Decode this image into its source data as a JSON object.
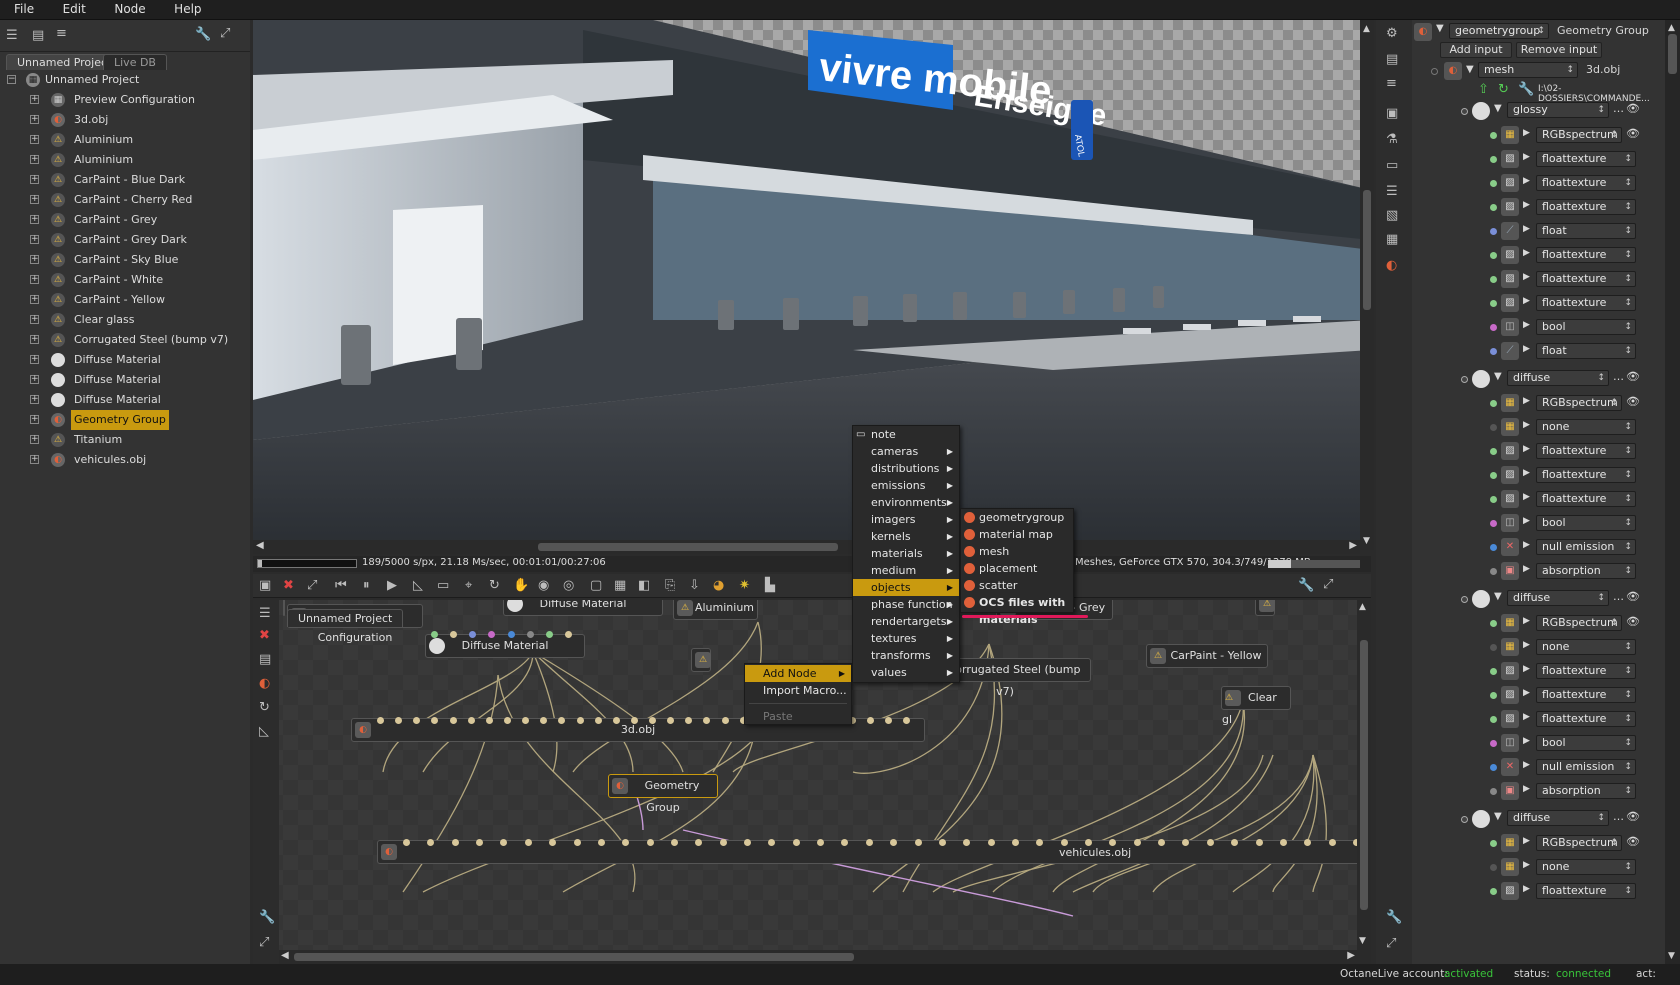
{
  "menubar": {
    "file": "File",
    "edit": "Edit",
    "node": "Node",
    "help": "Help"
  },
  "outliner": {
    "tabs": [
      "Unnamed Project",
      "Live DB"
    ],
    "root": "Unnamed Project",
    "items": [
      "Preview Configuration",
      "3d.obj",
      "Aluminium",
      "Aluminium",
      "CarPaint - Blue Dark",
      "CarPaint - Cherry Red",
      "CarPaint - Grey",
      "CarPaint - Grey Dark",
      "CarPaint - Sky Blue",
      "CarPaint - White",
      "CarPaint - Yellow",
      "Clear glass",
      "Corrugated Steel (bump v7)",
      "Diffuse Material",
      "Diffuse Material",
      "Diffuse Material",
      "Geometry Group",
      "Titanium",
      "vehicules.obj"
    ],
    "selected_index": 16
  },
  "viewport": {
    "signs": [
      "vivre mobile",
      "Enseigne",
      "ATOL"
    ],
    "status_left": "189/5000 s/px, 21.18 Ms/sec, 00:01:01/00:27:06",
    "status_right": "Meshes, GeForce GTX 570, 304.3/749/1279 MB",
    "render_progress": 0.038
  },
  "nodegraph": {
    "tab": "Unnamed Project",
    "nodes": {
      "preview": "Preview Configuration",
      "diffuse1": "Diffuse Material",
      "diffuse2": "Diffuse Material",
      "aluminium": "Aluminium",
      "carpaint_grey": "CarPaint - Grey",
      "carpaint_yellow": "CarPaint - Yellow",
      "corrugated": "Corrugated Steel (bump v7)",
      "clear": "Clear gl",
      "obj3d": "3d.obj",
      "geogroup": "Geometry Group",
      "vehicules": "vehicules.obj"
    }
  },
  "context_menu": {
    "add_node": "Add Node",
    "import_macro": "Import Macro...",
    "paste": "Paste"
  },
  "addnode_menu": [
    "note",
    "cameras",
    "distributions",
    "emissions",
    "environments",
    "imagers",
    "kernels",
    "materials",
    "medium",
    "objects",
    "phase function",
    "rendertargets",
    "textures",
    "transforms",
    "values"
  ],
  "objects_menu": [
    "geometrygroup",
    "material map",
    "mesh",
    "placement",
    "scatter",
    "OCS files with materials"
  ],
  "inspector": {
    "node_type": "geometrygroup",
    "node_name": "Geometry Group",
    "add_input": "Add input",
    "remove_input": "Remove input",
    "mesh_type": "mesh",
    "mesh_name": "3d.obj",
    "mesh_path": "I:\\02-DOSSIERS\\COMMANDE...",
    "groups": [
      {
        "type": "glossy",
        "items": [
          "RGBspectrum",
          "floattexture",
          "floattexture",
          "floattexture",
          "float",
          "floattexture",
          "floattexture",
          "floattexture",
          "bool",
          "float"
        ]
      },
      {
        "type": "diffuse",
        "items": [
          "RGBspectrum",
          "none",
          "floattexture",
          "floattexture",
          "floattexture",
          "bool",
          "null emission",
          "absorption"
        ]
      },
      {
        "type": "diffuse",
        "items": [
          "RGBspectrum",
          "none",
          "floattexture",
          "floattexture",
          "floattexture",
          "bool",
          "null emission",
          "absorption"
        ]
      },
      {
        "type": "diffuse",
        "items": [
          "RGBspectrum",
          "none",
          "floattexture"
        ]
      }
    ]
  },
  "statusbar": {
    "account_label": "OctaneLive account:",
    "account_value": "activated",
    "status_label": "status:",
    "status_value": "connected",
    "act_label": "act:"
  },
  "colors": {
    "accent": "#c99a0f",
    "highlight_underline": "#e0195a",
    "status_green": "#39c43a"
  }
}
